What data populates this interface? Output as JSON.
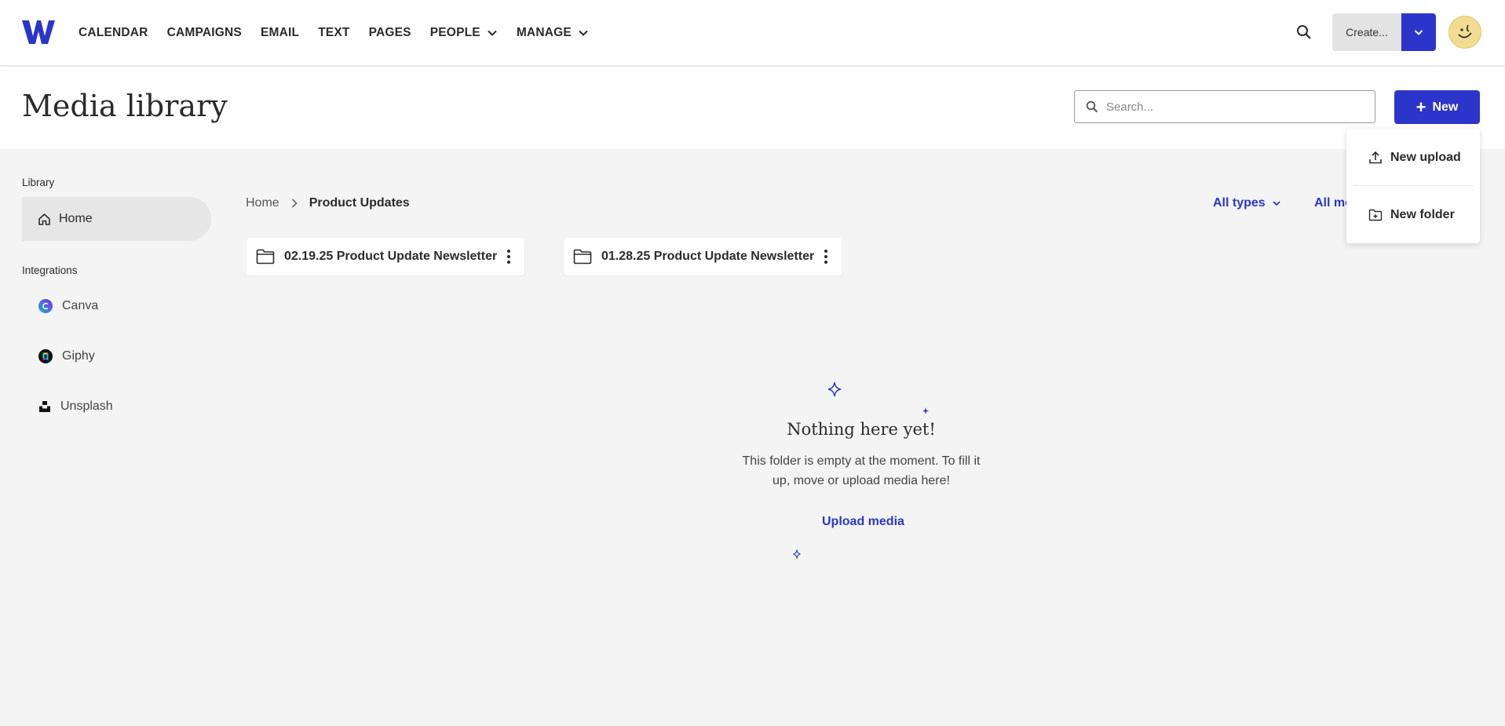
{
  "nav": {
    "items": [
      {
        "label": "CALENDAR"
      },
      {
        "label": "CAMPAIGNS"
      },
      {
        "label": "EMAIL"
      },
      {
        "label": "TEXT"
      },
      {
        "label": "PAGES"
      },
      {
        "label": "PEOPLE",
        "has_dropdown": true
      },
      {
        "label": "MANAGE",
        "has_dropdown": true
      }
    ],
    "create_label": "Create...",
    "brand_color": "#2b35c9"
  },
  "header": {
    "title": "Media library",
    "search_placeholder": "Search...",
    "new_button_label": "New"
  },
  "new_menu": {
    "items": [
      {
        "label": "New upload",
        "icon": "upload-icon"
      },
      {
        "label": "New folder",
        "icon": "folder-plus-icon"
      }
    ]
  },
  "sidebar": {
    "library_heading": "Library",
    "home_label": "Home",
    "integrations_heading": "Integrations",
    "integrations": [
      {
        "label": "Canva",
        "icon": "canva-icon"
      },
      {
        "label": "Giphy",
        "icon": "giphy-icon"
      },
      {
        "label": "Unsplash",
        "icon": "unsplash-icon"
      }
    ]
  },
  "breadcrumb": {
    "home": "Home",
    "current": "Product Updates"
  },
  "filters": {
    "type_label": "All types",
    "media_label": "All me"
  },
  "folders": [
    {
      "name": "02.19.25 Product Update Newsletter"
    },
    {
      "name": "01.28.25 Product Update Newsletter"
    }
  ],
  "empty_state": {
    "title": "Nothing here yet!",
    "text": "This folder is empty at the moment. To fill it up, move or upload media here!",
    "link": "Upload media"
  }
}
